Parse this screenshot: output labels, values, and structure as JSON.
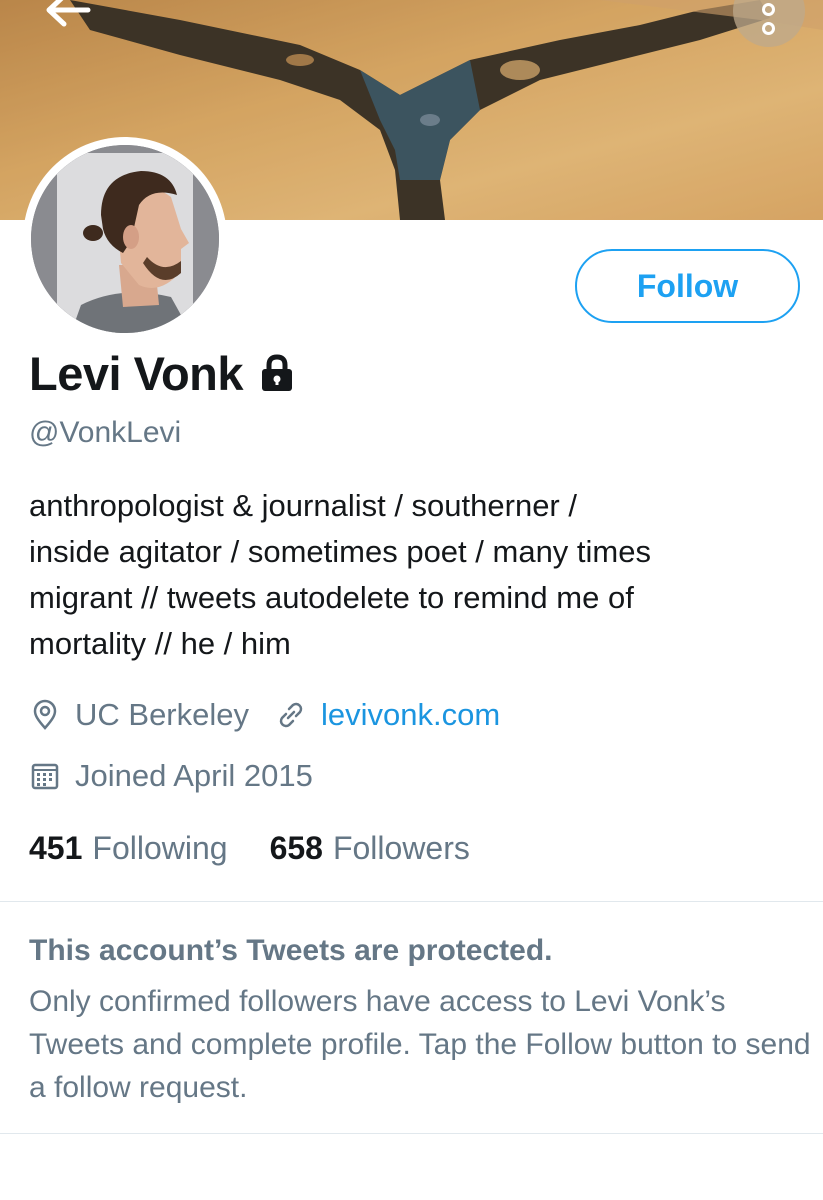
{
  "header": {
    "back_icon": "arrow-left-icon",
    "more_icon": "more-vertical-icon"
  },
  "profile": {
    "name": "Levi Vonk",
    "handle": "@VonkLevi",
    "protected_icon": "lock-icon",
    "follow_label": "Follow",
    "bio_lines": [
      "anthropologist & journalist / southerner /",
      "inside agitator / sometimes poet / many times",
      "migrant // tweets autodelete to remind me of",
      "mortality // he / him"
    ],
    "location": "UC Berkeley",
    "website": "levivonk.com",
    "joined": "Joined April 2015",
    "following_count": "451",
    "following_label": "Following",
    "followers_count": "658",
    "followers_label": "Followers"
  },
  "protected_notice": {
    "title": "This account’s Tweets are protected.",
    "body": "Only confirmed followers have access to Levi Vonk’s Tweets and complete profile. Tap the Follow button to send a follow request."
  },
  "colors": {
    "accent": "#1da1f2",
    "link": "#1b95e0",
    "secondary_text": "#657786",
    "divider": "#e1e8ed"
  }
}
